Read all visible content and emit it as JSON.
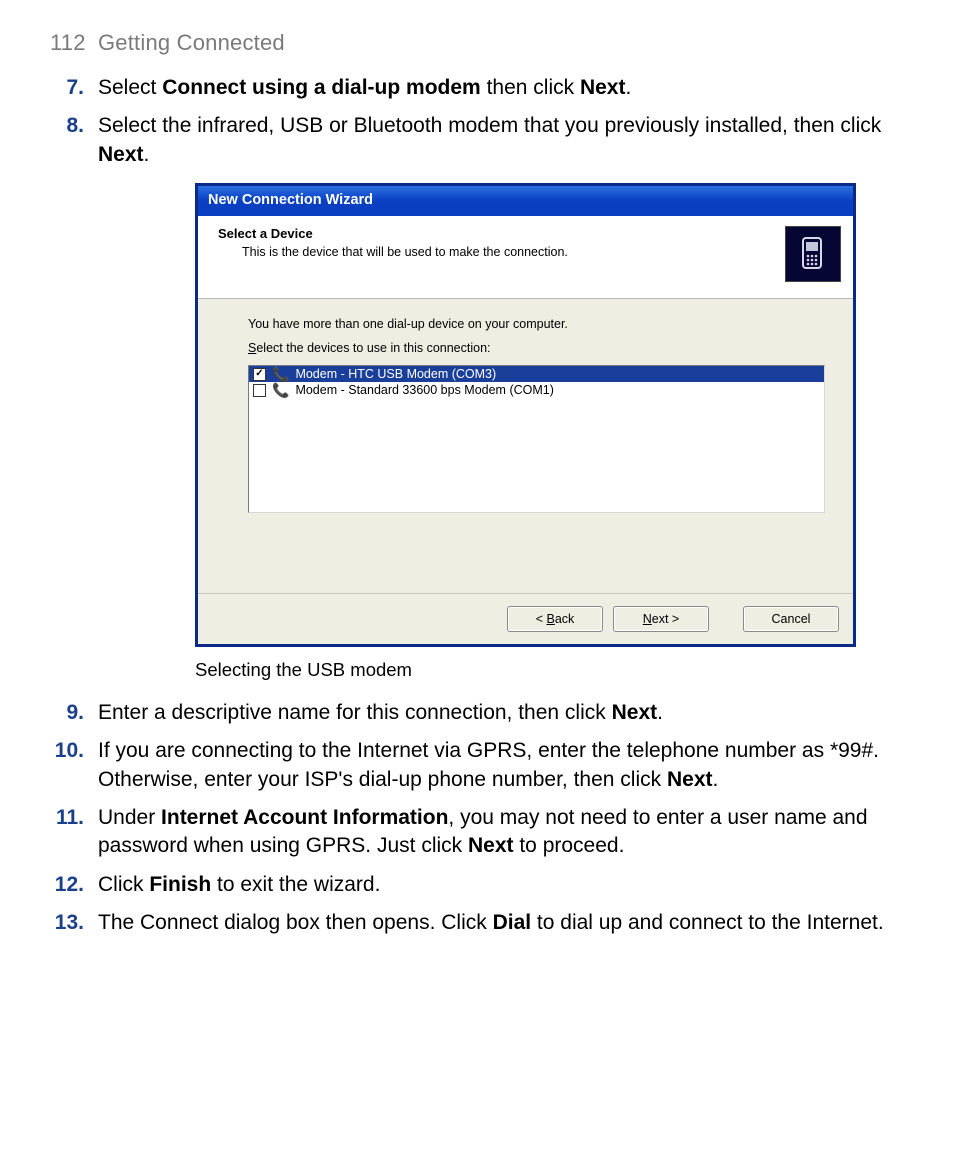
{
  "header": {
    "page_number": "112",
    "title": "Getting Connected"
  },
  "steps": [
    {
      "num": "7.",
      "segments": [
        {
          "t": "Select "
        },
        {
          "t": "Connect using a dial-up modem",
          "b": true
        },
        {
          "t": " then click "
        },
        {
          "t": "Next",
          "b": true
        },
        {
          "t": "."
        }
      ]
    },
    {
      "num": "8.",
      "segments": [
        {
          "t": "Select the infrared, USB or Bluetooth modem that you previously installed, then click "
        },
        {
          "t": "Next",
          "b": true
        },
        {
          "t": "."
        }
      ]
    },
    {
      "num": "9.",
      "segments": [
        {
          "t": "Enter a descriptive name for this connection, then click "
        },
        {
          "t": "Next",
          "b": true
        },
        {
          "t": "."
        }
      ]
    },
    {
      "num": "10.",
      "segments": [
        {
          "t": "If you are connecting to the Internet via GPRS, enter the telephone number as *99#. Otherwise, enter your ISP's dial-up phone number, then click "
        },
        {
          "t": "Next",
          "b": true
        },
        {
          "t": "."
        }
      ]
    },
    {
      "num": "11.",
      "segments": [
        {
          "t": "Under "
        },
        {
          "t": "Internet Account Information",
          "b": true
        },
        {
          "t": ", you may not need to enter a user name and password when using GPRS. Just click "
        },
        {
          "t": "Next",
          "b": true
        },
        {
          "t": " to proceed."
        }
      ]
    },
    {
      "num": "12.",
      "segments": [
        {
          "t": "Click "
        },
        {
          "t": "Finish",
          "b": true
        },
        {
          "t": " to exit the wizard."
        }
      ]
    },
    {
      "num": "13.",
      "segments": [
        {
          "t": "The Connect dialog box then opens. Click "
        },
        {
          "t": "Dial",
          "b": true
        },
        {
          "t": " to dial up and connect to the Internet."
        }
      ]
    }
  ],
  "wizard": {
    "title": "New Connection Wizard",
    "heading": "Select a Device",
    "subheading": "This is the device that will be used to make the connection.",
    "line1": "You have more than one dial-up device on your computer.",
    "line2_pre": "S",
    "line2_rest": "elect the devices to use in this connection:",
    "items": [
      {
        "checked": true,
        "selected": true,
        "label": "Modem - HTC USB Modem (COM3)"
      },
      {
        "checked": false,
        "selected": false,
        "label": "Modem - Standard 33600 bps Modem (COM1)"
      }
    ],
    "buttons": {
      "back": {
        "pre": "< ",
        "m": "B",
        "post": "ack"
      },
      "next": {
        "pre": "",
        "m": "N",
        "post": "ext >"
      },
      "cancel": {
        "pre": "Cancel",
        "m": "",
        "post": ""
      }
    }
  },
  "caption": "Selecting the USB modem"
}
